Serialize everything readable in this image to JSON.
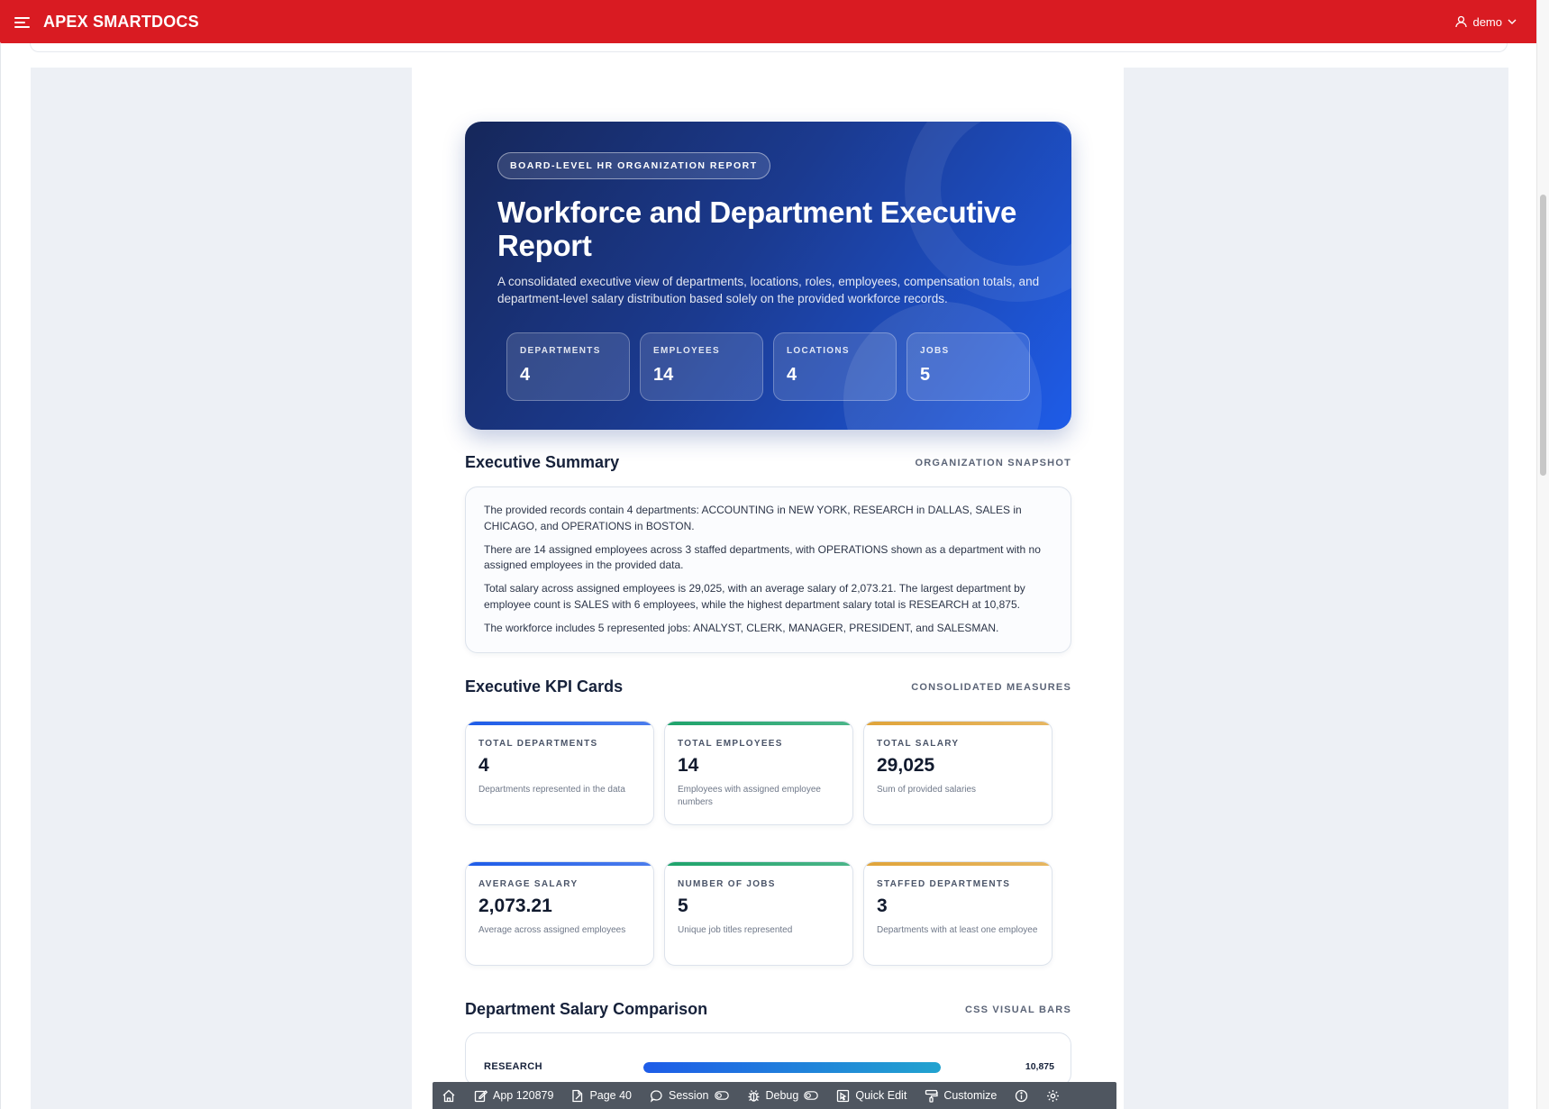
{
  "header": {
    "app_title": "APEX SMARTDOCS",
    "user": "demo"
  },
  "hero": {
    "badge": "BOARD-LEVEL HR ORGANIZATION REPORT",
    "title": "Workforce and Department Executive Report",
    "description": "A consolidated executive view of departments, locations, roles, employees, compensation totals, and department-level salary distribution based solely on the provided workforce records.",
    "stats": [
      {
        "label": "DEPARTMENTS",
        "value": "4"
      },
      {
        "label": "EMPLOYEES",
        "value": "14"
      },
      {
        "label": "LOCATIONS",
        "value": "4"
      },
      {
        "label": "JOBS",
        "value": "5"
      }
    ]
  },
  "summary": {
    "title": "Executive Summary",
    "tag": "ORGANIZATION SNAPSHOT",
    "paragraphs": [
      "The provided records contain 4 departments: ACCOUNTING in NEW YORK, RESEARCH in DALLAS, SALES in CHICAGO, and OPERATIONS in BOSTON.",
      "There are 14 assigned employees across 3 staffed departments, with OPERATIONS shown as a department with no assigned employees in the provided data.",
      "Total salary across assigned employees is 29,025, with an average salary of 2,073.21. The largest department by employee count is SALES with 6 employees, while the highest department salary total is RESEARCH at 10,875.",
      "The workforce includes 5 represented jobs: ANALYST, CLERK, MANAGER, PRESIDENT, and SALESMAN."
    ]
  },
  "kpis": {
    "title": "Executive KPI Cards",
    "tag": "CONSOLIDATED MEASURES",
    "cards": [
      {
        "label": "TOTAL DEPARTMENTS",
        "value": "4",
        "sub": "Departments represented in the data",
        "accent": "#1e5ce8"
      },
      {
        "label": "TOTAL EMPLOYEES",
        "value": "14",
        "sub": "Employees with assigned employee numbers",
        "accent": "#1ea36b"
      },
      {
        "label": "TOTAL SALARY",
        "value": "29,025",
        "sub": "Sum of provided salaries",
        "accent": "#e0a43a"
      },
      {
        "label": "AVERAGE SALARY",
        "value": "2,073.21",
        "sub": "Average across assigned employees",
        "accent": "#1e5ce8"
      },
      {
        "label": "NUMBER OF JOBS",
        "value": "5",
        "sub": "Unique job titles represented",
        "accent": "#1ea36b"
      },
      {
        "label": "STAFFED DEPARTMENTS",
        "value": "3",
        "sub": "Departments with at least one employee",
        "accent": "#e0a43a"
      }
    ]
  },
  "salary": {
    "title": "Department Salary Comparison",
    "tag": "CSS VISUAL BARS",
    "rows": [
      {
        "name": "RESEARCH",
        "value": "10,875",
        "fraction": 1.0
      }
    ]
  },
  "devbar": {
    "items": [
      {
        "icon": "home-icon",
        "label": ""
      },
      {
        "icon": "edit-icon",
        "label": "App 120879"
      },
      {
        "icon": "page-edit-icon",
        "label": "Page 40"
      },
      {
        "icon": "session-icon",
        "label": "Session"
      },
      {
        "icon": "debug-icon",
        "label": "Debug"
      },
      {
        "icon": "quick-edit-icon",
        "label": "Quick Edit"
      },
      {
        "icon": "customize-icon",
        "label": "Customize"
      },
      {
        "icon": "info-icon",
        "label": ""
      },
      {
        "icon": "gear-icon",
        "label": ""
      }
    ]
  },
  "colors": {
    "header": "#d91b22",
    "hero_start": "#16275a",
    "hero_end": "#1e5ce8",
    "devbar": "#4f5660"
  }
}
